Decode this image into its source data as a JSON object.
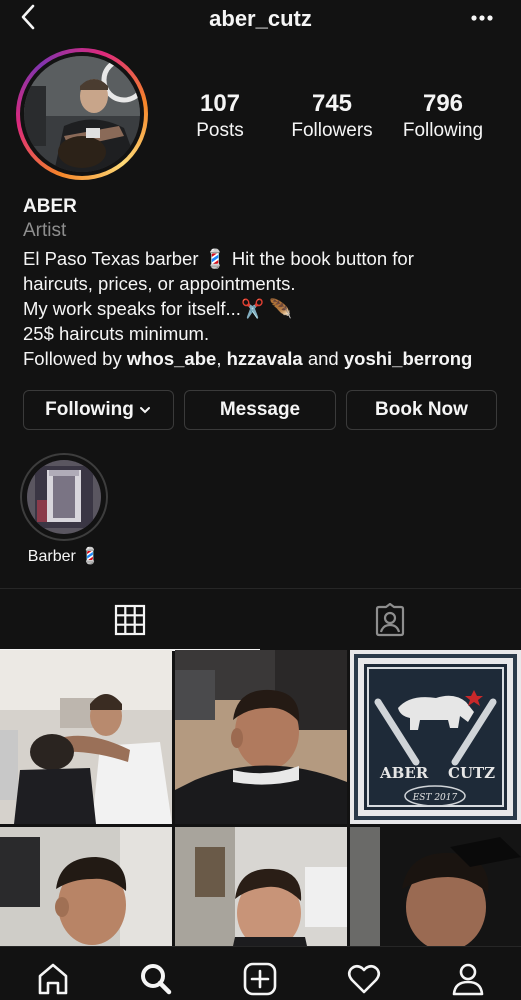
{
  "header": {
    "username": "aber_cutz"
  },
  "stats": [
    {
      "value": "107",
      "label": "Posts"
    },
    {
      "value": "745",
      "label": "Followers"
    },
    {
      "value": "796",
      "label": "Following"
    }
  ],
  "bio": {
    "name": "ABER",
    "category": "Artist",
    "line1": "El Paso Texas barber 💈 Hit the book button for",
    "line2": "haircuts, prices, or appointments.",
    "line3": "My work speaks for itself...✂️ 🪶",
    "line4": "25$ haircuts minimum.",
    "followed_prefix": "Followed by ",
    "followed_user1": "whos_abe",
    "followed_sep": ", ",
    "followed_user2": "hzzavala",
    "followed_and": " and ",
    "followed_user3": "yoshi_berrong"
  },
  "buttons": {
    "following": "Following",
    "message": "Message",
    "book": "Book Now"
  },
  "highlight": {
    "label": "Barber 💈"
  },
  "post_logo": {
    "text_left": "ABER",
    "text_right": "CUTZ",
    "est": "EST 2017"
  },
  "colors": {
    "background": "#121212",
    "text": "#f5f5f5",
    "muted": "#8e8e8e",
    "border": "#3a3a3a"
  },
  "icons": {
    "back": "chevron-left-icon",
    "more": "more-horizontal-icon",
    "grid": "grid-icon",
    "tagged": "tagged-user-icon",
    "home": "home-icon",
    "search": "search-icon",
    "new_post": "add-post-icon",
    "activity": "heart-icon",
    "profile": "profile-icon"
  }
}
